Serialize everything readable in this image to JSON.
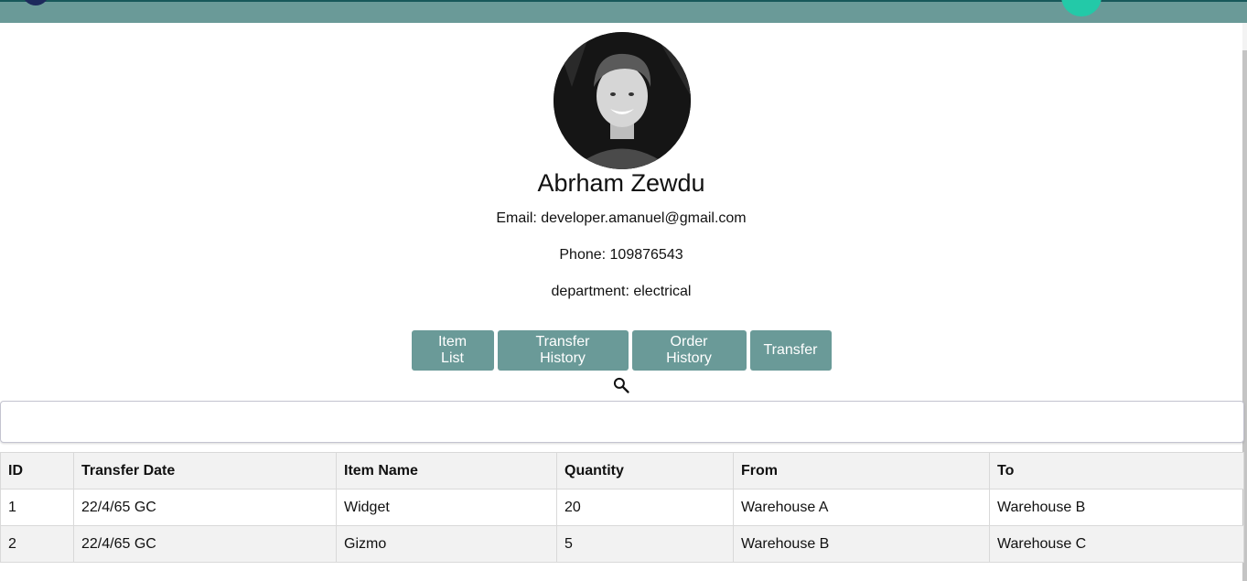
{
  "profile": {
    "name": "Abrham Zewdu",
    "email": "Email: developer.amanuel@gmail.com",
    "phone": "Phone: 109876543",
    "department": "department: electrical"
  },
  "nav": {
    "item_list": "Item List",
    "transfer_history": "Transfer History",
    "order_history": "Order History",
    "transfer": "Transfer"
  },
  "search": {
    "value": "",
    "icon": "search-icon"
  },
  "table": {
    "headers": [
      "ID",
      "Transfer Date",
      "Item Name",
      "Quantity",
      "From",
      "To"
    ],
    "rows": [
      [
        "1",
        "22/4/65 GC",
        "Widget",
        "20",
        "Warehouse A",
        "Warehouse B"
      ],
      [
        "2",
        "22/4/65 GC",
        "Gizmo",
        "5",
        "Warehouse B",
        "Warehouse C"
      ]
    ]
  },
  "colors": {
    "accent": "#6a9a98",
    "topbar_border": "#17585a"
  }
}
